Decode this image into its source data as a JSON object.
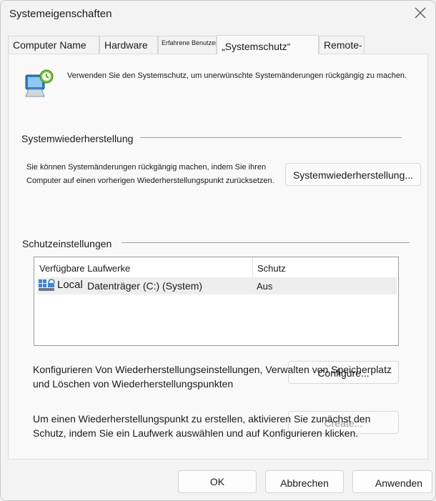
{
  "window": {
    "title": "Systemeigenschaften"
  },
  "tabs": [
    {
      "label": "Computer Name"
    },
    {
      "label": "Hardware"
    },
    {
      "label": "Erfahrene Benutzer"
    },
    {
      "label": "„Systemschutz“"
    },
    {
      "label": "Remote-"
    }
  ],
  "intro": {
    "text": "Verwenden Sie den Systemschutz, um unerwünschte Systemänderungen rückgängig zu machen."
  },
  "restore": {
    "heading": "Systemwiederherstellung",
    "line1": "Sie können Systemänderungen rückgängig machen, indem Sie ihren",
    "line2": "Computer auf einen vorherigen Wiederherstellungspunkt zurücksetzen.",
    "button": "Systemwiederherstellung..."
  },
  "protection": {
    "heading": "Schutzeinstellungen",
    "columns": [
      "Verfügbare Laufwerke",
      "Schutz"
    ],
    "drive": {
      "prefix": "Local",
      "name": "Datenträger (C:) (System)",
      "status": "Aus"
    },
    "configure_line1": "Konfigurieren Von Wiederherstellungseinstellungen, Verwalten von Speicherplatz",
    "configure_line2": "und Löschen von Wiederherstellungspunkten",
    "configure_button": "Configure...",
    "create_line1": "Um einen Wiederherstellungspunkt zu erstellen, aktivieren Sie zunächst den",
    "create_line2": "Schutz, indem Sie ein Laufwerk auswählen und auf Konfigurieren klicken.",
    "create_button": "Create..."
  },
  "footer": {
    "ok": "OK",
    "cancel": "Abbrechen",
    "apply": "Anwenden"
  }
}
